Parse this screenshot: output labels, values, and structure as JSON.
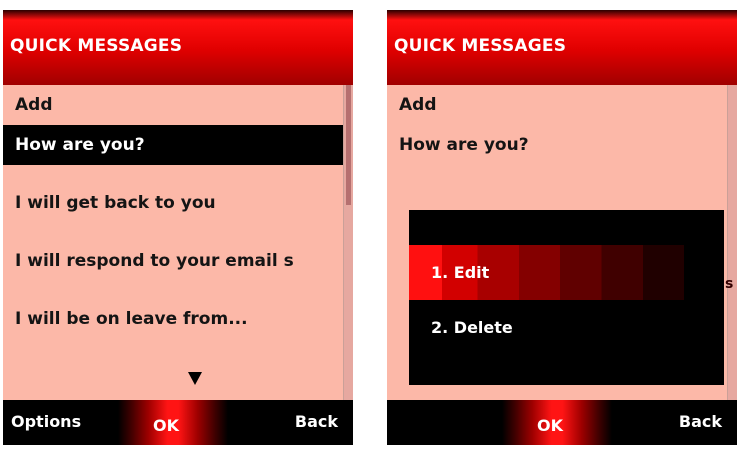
{
  "left_screen": {
    "title": "QUICK MESSAGES",
    "items": [
      {
        "label": "Add"
      },
      {
        "label": "How are you?"
      },
      {
        "label": "I will get back to you"
      },
      {
        "label": "I will respond to your email s"
      },
      {
        "label": "I will be on leave from..."
      }
    ],
    "softkeys": {
      "left": "Options",
      "center": "OK",
      "right": "Back"
    }
  },
  "right_screen": {
    "title": "QUICK MESSAGES",
    "items": [
      {
        "label": "Add"
      },
      {
        "label": "How are you?"
      }
    ],
    "popup": {
      "items": [
        {
          "label": "1. Edit"
        },
        {
          "label": "2. Delete"
        }
      ],
      "edge_glyph": "s"
    },
    "softkeys": {
      "center": "OK",
      "right": "Back"
    }
  },
  "colors": {
    "title_red": "#e00000",
    "list_background": "#fcb8a8",
    "selection": "#000000",
    "softkey_bar": "#000000"
  }
}
